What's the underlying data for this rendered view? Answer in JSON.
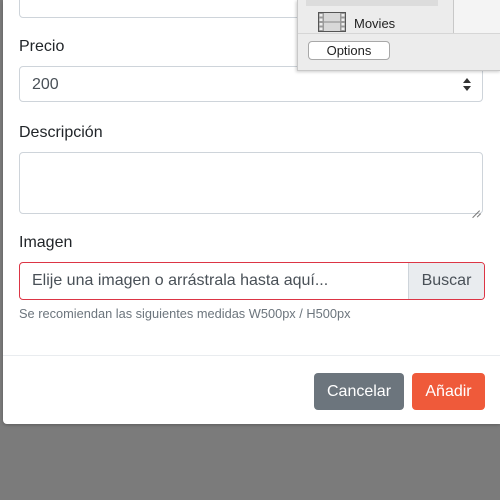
{
  "form": {
    "price_label": "Precio",
    "price_value": "200",
    "description_label": "Descripción",
    "description_value": "",
    "image_label": "Imagen",
    "image_placeholder": "Elije una imagen o arrástrala hasta aquí...",
    "browse_label": "Buscar",
    "image_hint": "Se recomiendan las siguientes medidas W500px / H500px"
  },
  "footer": {
    "cancel_label": "Cancelar",
    "add_label": "Añadir"
  },
  "overlay": {
    "item_label": "Movies",
    "item_icon": "film-icon",
    "options_label": "Options"
  },
  "colors": {
    "add_button": "#ef5a3a",
    "cancel_button": "#6c757d",
    "invalid_border": "#dc3545"
  }
}
